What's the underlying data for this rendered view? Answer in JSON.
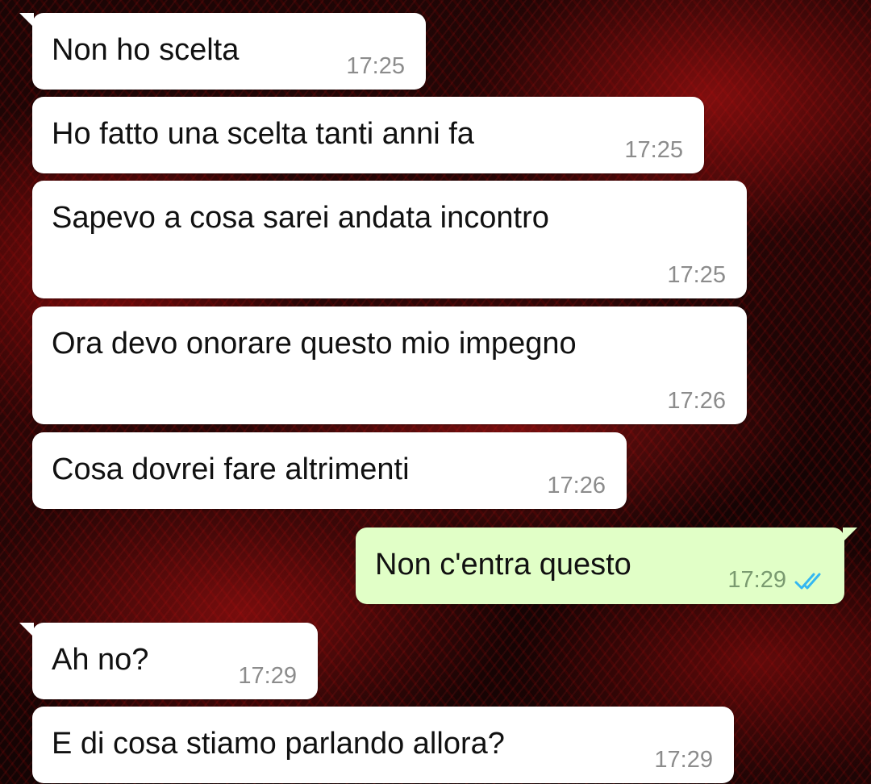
{
  "colors": {
    "incoming_bubble": "#ffffff",
    "outgoing_bubble": "#e1ffc7",
    "timestamp": "#8c8c8c",
    "read_ticks": "#34b7f1"
  },
  "messages": [
    {
      "direction": "in",
      "text": "Non ho scelta",
      "time": "17:25"
    },
    {
      "direction": "in",
      "text": "Ho fatto una scelta tanti anni fa",
      "time": "17:25"
    },
    {
      "direction": "in",
      "text": "Sapevo a cosa sarei andata incontro",
      "time": "17:25"
    },
    {
      "direction": "in",
      "text": "Ora devo onorare questo mio impegno",
      "time": "17:26"
    },
    {
      "direction": "in",
      "text": "Cosa dovrei fare altrimenti",
      "time": "17:26"
    },
    {
      "direction": "out",
      "text": "Non c'entra questo",
      "time": "17:29",
      "status_icon": "double-check-read-icon"
    },
    {
      "direction": "in",
      "text": "Ah no?",
      "time": "17:29"
    },
    {
      "direction": "in",
      "text": "E di cosa stiamo parlando allora?",
      "time": "17:29"
    }
  ]
}
